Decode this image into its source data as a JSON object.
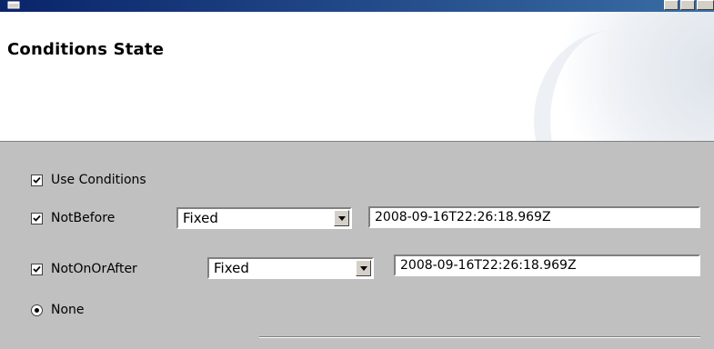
{
  "header": {
    "title": "Conditions State"
  },
  "use_conditions": {
    "label": "Use Conditions",
    "checked": true
  },
  "not_before": {
    "label": "NotBefore",
    "checked": true,
    "mode": "Fixed",
    "value": "2008-09-16T22:26:18.969Z"
  },
  "not_on_or_after": {
    "label": "NotOnOrAfter",
    "checked": true,
    "mode": "Fixed",
    "value": "2008-09-16T22:26:18.969Z"
  },
  "none_option": {
    "label": "None",
    "selected": true
  },
  "icons": {
    "checkmark": "checkmark-icon",
    "dropdown": "chevron-down-icon",
    "window": "window-icon"
  },
  "colors": {
    "dialog_bg": "#c0c0c0",
    "header_bg": "#ffffff",
    "titlebar": "#0a246a"
  }
}
